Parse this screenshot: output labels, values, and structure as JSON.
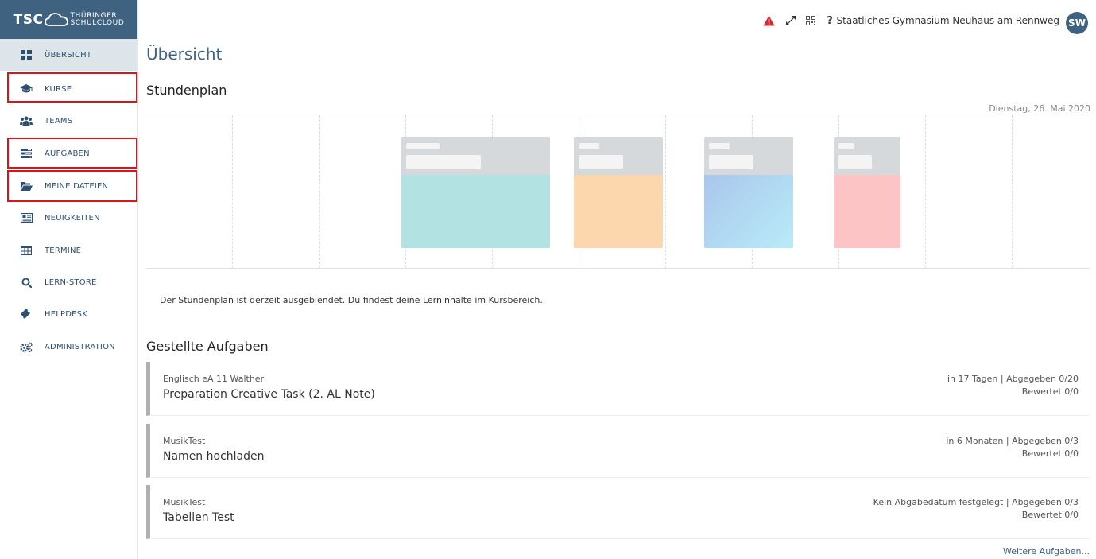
{
  "brand": {
    "short": "TSC",
    "line1": "THÜRINGER",
    "line2": "SCHULCLOUD"
  },
  "sidebar": {
    "items": [
      {
        "label": "ÜBERSICHT",
        "icon": "dashboard-icon"
      },
      {
        "label": "KURSE",
        "icon": "graduation-cap-icon"
      },
      {
        "label": "TEAMS",
        "icon": "users-icon"
      },
      {
        "label": "AUFGABEN",
        "icon": "tasks-icon"
      },
      {
        "label": "MEINE DATEIEN",
        "icon": "folder-icon"
      },
      {
        "label": "NEUIGKEITEN",
        "icon": "newspaper-icon"
      },
      {
        "label": "TERMINE",
        "icon": "calendar-table-icon"
      },
      {
        "label": "LERN-STORE",
        "icon": "search-icon"
      },
      {
        "label": "HELPDESK",
        "icon": "ticket-icon"
      },
      {
        "label": "ADMINISTRATION",
        "icon": "cogs-icon"
      }
    ]
  },
  "topbar": {
    "help_label": "?",
    "school": "Staatliches Gymnasium Neuhaus am Rennweg",
    "avatar": "SW",
    "icons": [
      "warning-icon",
      "fullscreen-icon",
      "qr-code-icon",
      "help-icon"
    ]
  },
  "main": {
    "title": "Übersicht",
    "timetable_heading": "Stundenplan",
    "date": "Dienstag, 26. Mai 2020",
    "notice": "Der Stundenplan ist derzeit ausgeblendet. Du findest deine Lerninhalte im Kursbereich.",
    "tasks_heading": "Gestellte Aufgaben",
    "tasks": [
      {
        "course": "Englisch eA 11 Walther",
        "name": "Preparation Creative Task (2. AL Note)",
        "due": "in 17 Tagen | Abgegeben 0/20",
        "graded": "Bewertet 0/0"
      },
      {
        "course": "MusikTest",
        "name": "Namen hochladen",
        "due": "in 6 Monaten | Abgegeben 0/3",
        "graded": "Bewertet 0/0"
      },
      {
        "course": "MusikTest",
        "name": "Tabellen Test",
        "due": "Kein Abgabedatum festgelegt | Abgegeben 0/3",
        "graded": "Bewertet 0/0"
      }
    ],
    "more_link": "Weitere Aufgaben..."
  },
  "colors": {
    "brand": "#3f6280",
    "highlight": "#d9151a",
    "warning": "#e0242a"
  }
}
